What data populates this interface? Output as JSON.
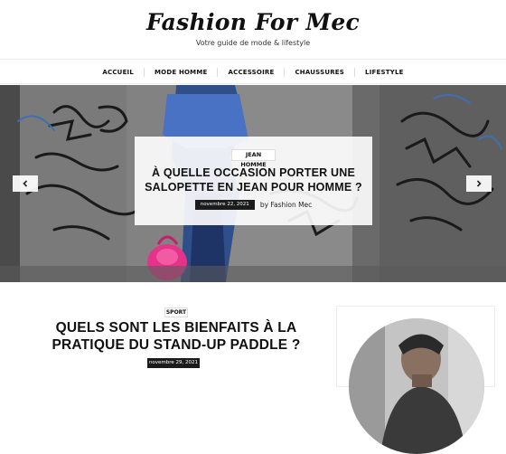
{
  "site": {
    "title": "Fashion For Mec",
    "tagline": "Votre guide de mode & lifestyle"
  },
  "nav": {
    "items": [
      {
        "label": "ACCUEIL"
      },
      {
        "label": "MODE HOMME"
      },
      {
        "label": "ACCESSOIRE"
      },
      {
        "label": "CHAUSSURES"
      },
      {
        "label": "LIFESTYLE"
      }
    ]
  },
  "hero": {
    "category": "JEAN HOMME",
    "title": "À QUELLE OCCASION PORTER UNE SALOPETTE EN JEAN POUR HOMME ?",
    "date": "novembre 22, 2021",
    "byline": "by Fashion Mec",
    "prev_icon": "chevron-left-icon",
    "next_icon": "chevron-right-icon"
  },
  "post": {
    "category": "SPORT",
    "title": "QUELS SONT LES BIENFAITS À LA PRATIQUE DU STAND-UP PADDLE ?",
    "date": "novembre 29, 2021"
  },
  "colors": {
    "accent_dark": "#1b1b1b",
    "border": "#ececec"
  }
}
